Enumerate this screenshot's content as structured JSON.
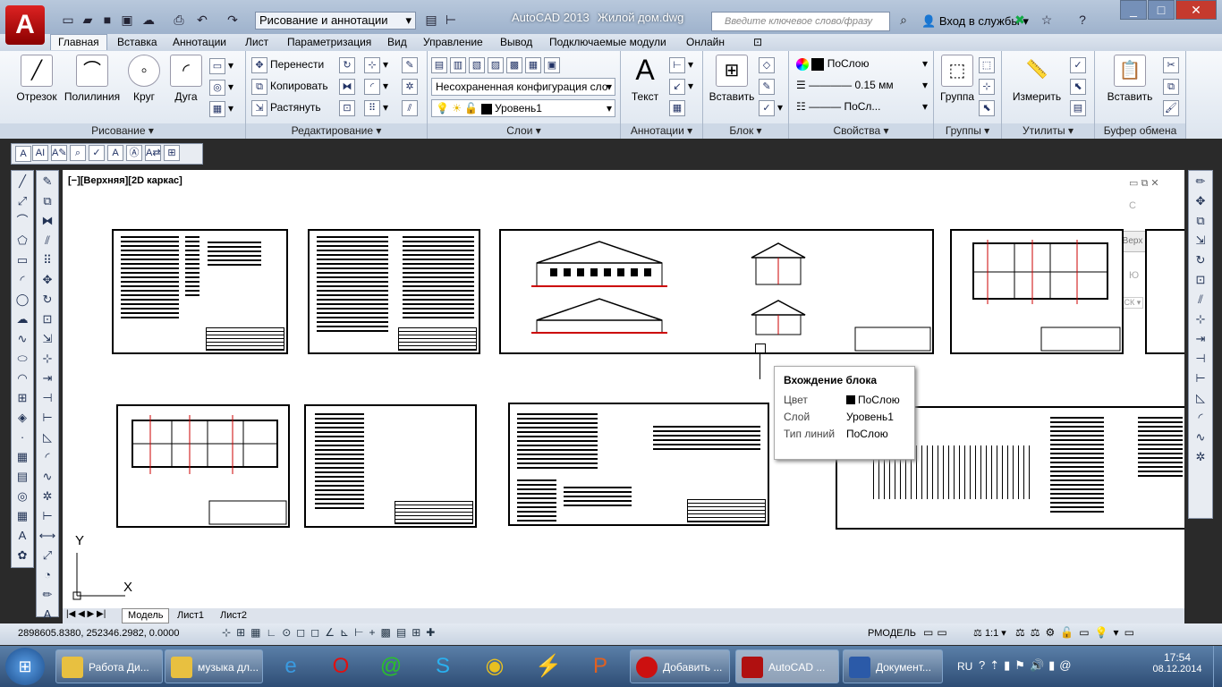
{
  "app": {
    "title": "AutoCAD 2013",
    "filename": "Жилой дом.dwg",
    "workspace": "Рисование и аннотации",
    "search_placeholder": "Введите ключевое слово/фразу",
    "login": "Вход в службы",
    "app_letter": "A"
  },
  "tabs": [
    "Главная",
    "Вставка",
    "Аннотации",
    "Лист",
    "Параметризация",
    "Вид",
    "Управление",
    "Вывод",
    "Подключаемые модули",
    "Онлайн"
  ],
  "ribbon": {
    "draw": {
      "label": "Рисование",
      "line": "Отрезок",
      "polyline": "Полилиния",
      "circle": "Круг",
      "arc": "Дуга"
    },
    "modify": {
      "label": "Редактирование",
      "move": "Перенести",
      "copy": "Копировать",
      "stretch": "Растянуть"
    },
    "layers": {
      "label": "Слои",
      "config": "Несохраненная конфигурация сло",
      "layer": "Уровень1"
    },
    "annotation": {
      "label": "Аннотации",
      "text": "Текст"
    },
    "block": {
      "label": "Блок",
      "insert": "Вставить"
    },
    "properties": {
      "label": "Свойства",
      "color": "ПоСлою",
      "lineweight": "0.15 мм",
      "linetype": "ПоСл..."
    },
    "groups": {
      "label": "Группы",
      "group": "Группа"
    },
    "utilities": {
      "label": "Утилиты",
      "measure": "Измерить"
    },
    "clipboard": {
      "label": "Буфер обмена",
      "paste": "Вставить"
    }
  },
  "viewport": {
    "label": "[−][Верхняя][2D каркас]",
    "viewcube_top": "Верх",
    "viewcube_n": "С",
    "viewcube_s": "Ю",
    "ucs": "МСК",
    "axis_x": "X",
    "axis_y": "Y"
  },
  "tooltip": {
    "title": "Вхождение блока",
    "rows": [
      {
        "k": "Цвет",
        "v": "ПоСлою"
      },
      {
        "k": "Слой",
        "v": "Уровень1"
      },
      {
        "k": "Тип линий",
        "v": "ПоСлою"
      }
    ]
  },
  "layout_tabs": [
    "Модель",
    "Лист1",
    "Лист2"
  ],
  "status": {
    "coords": "2898605.8380, 252346.2982, 0.0000",
    "space": "РМОДЕЛЬ",
    "scale": "1:1"
  },
  "taskbar": {
    "items": [
      {
        "label": "Работа Ди...",
        "color": "#e8c040"
      },
      {
        "label": "музыка дл...",
        "color": "#e8c040"
      },
      {
        "label": "Добавить ...",
        "color": "#cc1010"
      },
      {
        "label": "AutoCAD ...",
        "color": "#b01010"
      },
      {
        "label": "Документ...",
        "color": "#2b5aa8"
      }
    ],
    "lang": "RU",
    "time": "17:54",
    "date": "08.12.2014"
  }
}
